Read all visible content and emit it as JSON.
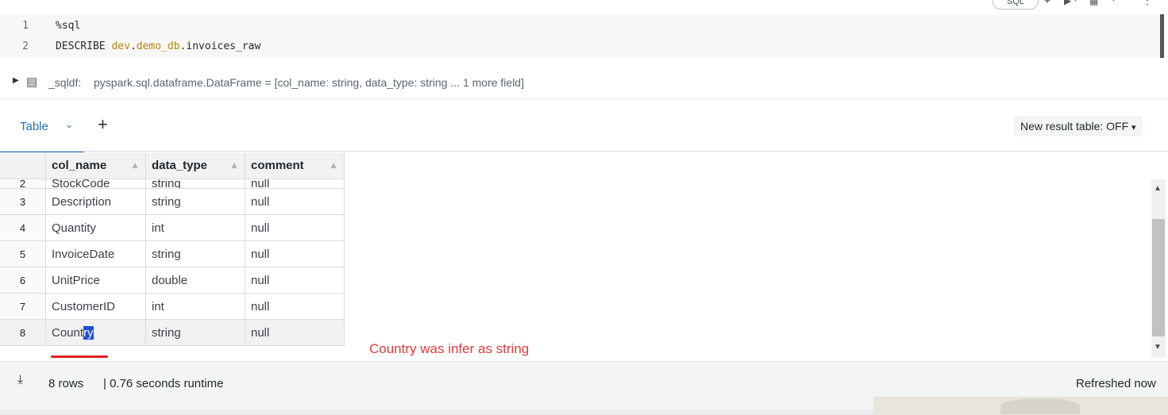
{
  "toolbar": {
    "lang_label": "SQL"
  },
  "editor": {
    "lines": [
      {
        "num": "1",
        "text": "%sql"
      },
      {
        "num": "2",
        "keyword": "DESCRIBE ",
        "ns": "dev",
        "dot1": ".",
        "db": "demo_db",
        "rest": ".invoices_raw"
      }
    ]
  },
  "dataframe": {
    "var": "_sqldf:",
    "type_text": "pyspark.sql.dataframe.DataFrame = [col_name: string, data_type: string ... 1 more field]"
  },
  "result": {
    "tab_label": "Table",
    "new_result_label": "New result table: OFF",
    "columns": [
      "col_name",
      "data_type",
      "comment"
    ],
    "rows": [
      {
        "idx": "2",
        "col_name": "StockCode",
        "data_type": "string",
        "comment": "null"
      },
      {
        "idx": "3",
        "col_name": "Description",
        "data_type": "string",
        "comment": "null"
      },
      {
        "idx": "4",
        "col_name": "Quantity",
        "data_type": "int",
        "comment": "null"
      },
      {
        "idx": "5",
        "col_name": "InvoiceDate",
        "data_type": "string",
        "comment": "null"
      },
      {
        "idx": "6",
        "col_name": "UnitPrice",
        "data_type": "double",
        "comment": "null"
      },
      {
        "idx": "7",
        "col_name": "CustomerID",
        "data_type": "int",
        "comment": "null"
      },
      {
        "idx": "8",
        "col_name_pre": "Count",
        "col_name_sel": "ry",
        "data_type": "string",
        "comment": "null"
      }
    ]
  },
  "annotation": {
    "text": "Country was infer as string",
    "color": "#e53a3a"
  },
  "footer": {
    "rows_label": "8 rows",
    "runtime_label": "| 0.76 seconds runtime",
    "refreshed_label": "Refreshed now"
  },
  "colors": {
    "accent": "#2272b4",
    "selection": "#1f4fd6"
  }
}
